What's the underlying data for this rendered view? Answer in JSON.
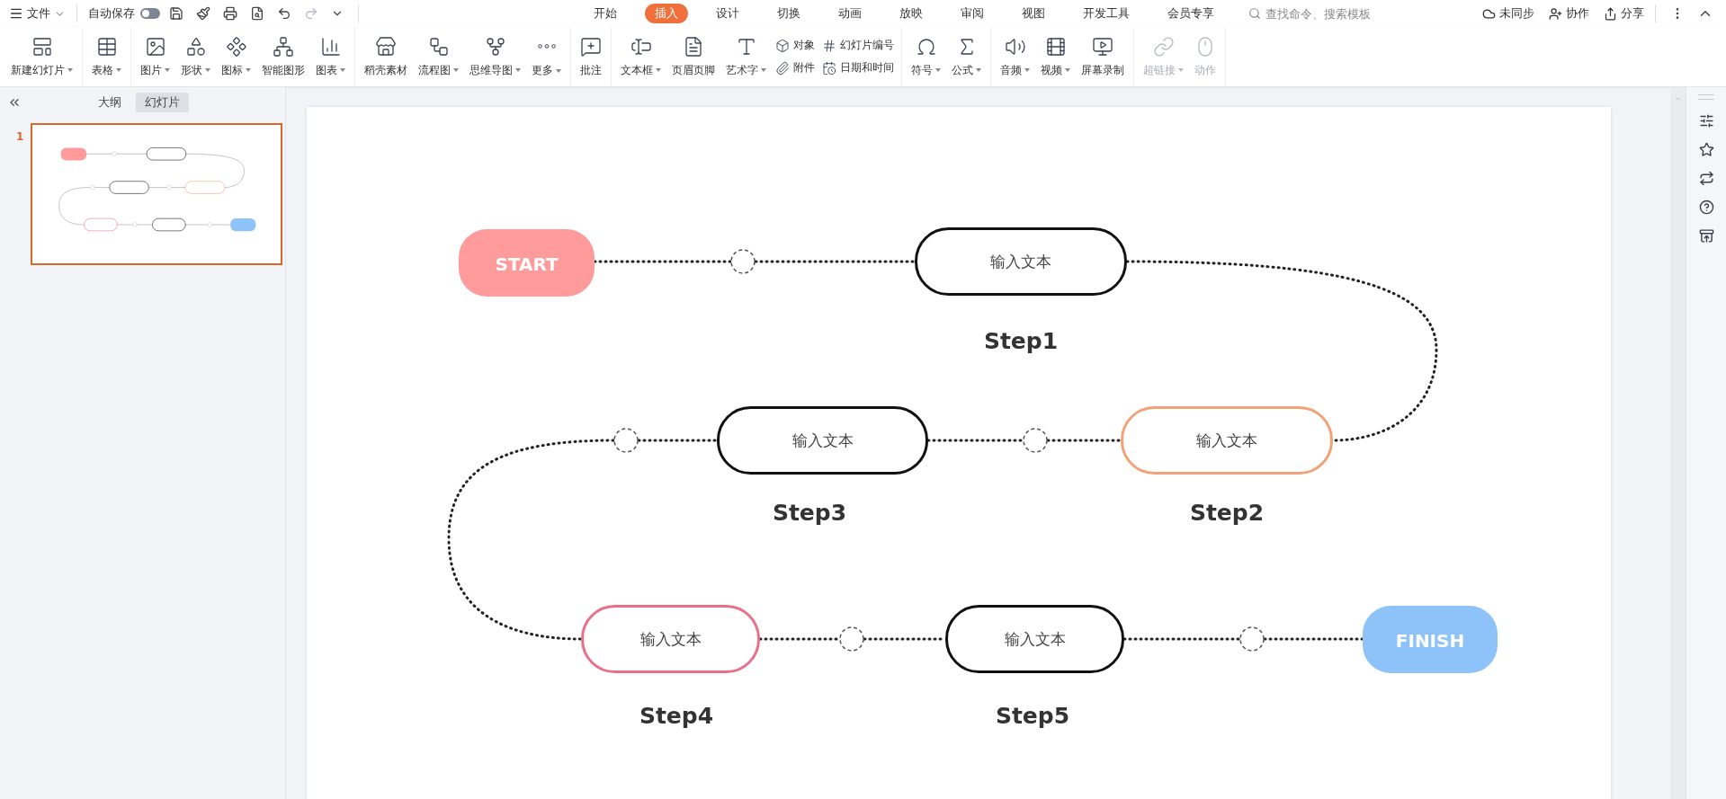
{
  "menu_bar": {
    "file_menu": "文件",
    "autosave": {
      "label": "自动保存",
      "on": false
    },
    "tabs": [
      {
        "label": "开始",
        "selected": false
      },
      {
        "label": "插入",
        "selected": true
      },
      {
        "label": "设计",
        "selected": false
      },
      {
        "label": "切换",
        "selected": false
      },
      {
        "label": "动画",
        "selected": false
      },
      {
        "label": "放映",
        "selected": false
      },
      {
        "label": "审阅",
        "selected": false
      },
      {
        "label": "视图",
        "selected": false
      },
      {
        "label": "开发工具",
        "selected": false
      },
      {
        "label": "会员专享",
        "selected": false
      }
    ],
    "search": {
      "placeholder": "查找命令、搜索模板"
    },
    "actions": [
      "未同步",
      "协作",
      "分享"
    ]
  },
  "ribbon": {
    "groups": [
      [
        {
          "kind": "large",
          "label": "新建幻灯片",
          "dropdown": true,
          "disabled": false
        }
      ],
      [
        {
          "kind": "large",
          "label": "表格",
          "dropdown": true,
          "disabled": false
        }
      ],
      [
        {
          "kind": "large",
          "label": "图片",
          "dropdown": true,
          "disabled": false
        },
        {
          "kind": "large",
          "label": "形状",
          "dropdown": true,
          "disabled": false
        },
        {
          "kind": "large",
          "label": "图标",
          "dropdown": true,
          "disabled": false
        },
        {
          "kind": "large",
          "label": "智能图形",
          "dropdown": false,
          "disabled": false
        },
        {
          "kind": "large",
          "label": "图表",
          "dropdown": true,
          "disabled": false
        }
      ],
      [
        {
          "kind": "large",
          "label": "稻壳素材",
          "dropdown": false,
          "disabled": false
        },
        {
          "kind": "large",
          "label": "流程图",
          "dropdown": true,
          "disabled": false
        },
        {
          "kind": "large",
          "label": "思维导图",
          "dropdown": true,
          "disabled": false
        },
        {
          "kind": "large",
          "label": "更多",
          "dropdown": true,
          "disabled": false
        }
      ],
      [
        {
          "kind": "large",
          "label": "批注",
          "dropdown": false,
          "disabled": false
        }
      ],
      [
        {
          "kind": "large",
          "label": "文本框",
          "dropdown": true,
          "disabled": false
        },
        {
          "kind": "large",
          "label": "页眉页脚",
          "dropdown": false,
          "disabled": false
        },
        {
          "kind": "large",
          "label": "艺术字",
          "dropdown": true,
          "disabled": false
        },
        {
          "kind": "small",
          "label": "对象",
          "dropdown": false,
          "disabled": false
        },
        {
          "kind": "small",
          "label": "附件",
          "dropdown": false,
          "disabled": false
        },
        {
          "kind": "small",
          "label": "幻灯片编号",
          "dropdown": false,
          "disabled": false
        },
        {
          "kind": "small",
          "label": "日期和时间",
          "dropdown": false,
          "disabled": false
        }
      ],
      [
        {
          "kind": "large",
          "label": "符号",
          "dropdown": true,
          "disabled": false
        },
        {
          "kind": "large",
          "label": "公式",
          "dropdown": true,
          "disabled": false
        }
      ],
      [
        {
          "kind": "large",
          "label": "音频",
          "dropdown": true,
          "disabled": false
        },
        {
          "kind": "large",
          "label": "视频",
          "dropdown": true,
          "disabled": false
        },
        {
          "kind": "large",
          "label": "屏幕录制",
          "dropdown": false,
          "disabled": false
        }
      ],
      [
        {
          "kind": "large",
          "label": "超链接",
          "dropdown": true,
          "disabled": true
        },
        {
          "kind": "large",
          "label": "动作",
          "dropdown": false,
          "disabled": true
        }
      ]
    ]
  },
  "left_panel": {
    "tabs": [
      {
        "label": "大纲",
        "selected": false
      },
      {
        "label": "幻灯片",
        "selected": true
      }
    ],
    "slides": [
      {
        "number": "1",
        "selected": true
      }
    ]
  },
  "slide": {
    "nodes": [
      {
        "kind": "terminal",
        "label": "START",
        "color": "#ff9b9b"
      },
      {
        "kind": "step",
        "text": "输入文本",
        "caption": "Step1",
        "color": "#111111"
      },
      {
        "kind": "step",
        "text": "输入文本",
        "caption": "Step3",
        "color": "#111111"
      },
      {
        "kind": "step",
        "text": "输入文本",
        "caption": "Step2",
        "color": "#f0a378"
      },
      {
        "kind": "step",
        "text": "输入文本",
        "caption": "Step4",
        "color": "#e8708c"
      },
      {
        "kind": "step",
        "text": "输入文本",
        "caption": "Step5",
        "color": "#111111"
      },
      {
        "kind": "terminal",
        "label": "FINISH",
        "color": "#8ec3fa"
      }
    ]
  }
}
